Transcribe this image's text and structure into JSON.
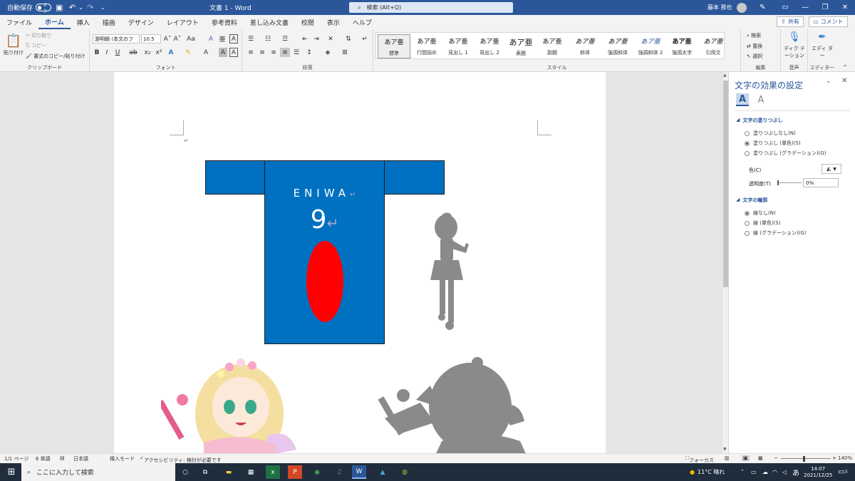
{
  "titlebar": {
    "autosave_label": "自動保存",
    "autosave_state": "オフ",
    "doc_title": "文書 1  -  Word",
    "search_placeholder": "検索 (Alt+Q)",
    "user_name": "藤本 那也"
  },
  "tabs": [
    "ファイル",
    "ホーム",
    "挿入",
    "描画",
    "デザイン",
    "レイアウト",
    "参考資料",
    "差し込み文書",
    "校閲",
    "表示",
    "ヘルプ"
  ],
  "active_tab": "ホーム",
  "share": {
    "share_label": "共有",
    "comment_label": "コメント"
  },
  "ribbon": {
    "clipboard": {
      "paste": "貼り付け",
      "cut": "切り取り",
      "copy": "コピー",
      "format_painter": "書式のコピー/貼り付け",
      "label": "クリップボード"
    },
    "font": {
      "font_name": "游明朝 (本文のフ",
      "font_size": "10.5",
      "label": "フォント"
    },
    "paragraph": {
      "label": "段落"
    },
    "styles": {
      "label": "スタイル",
      "items": [
        {
          "sample": "あア亜",
          "name": "標準"
        },
        {
          "sample": "あア亜",
          "name": "行間詰め"
        },
        {
          "sample": "あア亜",
          "name": "見出し 1"
        },
        {
          "sample": "あア亜",
          "name": "見出し 2"
        },
        {
          "sample": "あア亜",
          "name": "表題"
        },
        {
          "sample": "あア亜",
          "name": "副題"
        },
        {
          "sample": "あア亜",
          "name": "斜体"
        },
        {
          "sample": "あア亜",
          "name": "強調斜体"
        },
        {
          "sample": "あア亜",
          "name": "強調斜体 2"
        },
        {
          "sample": "あア亜",
          "name": "強調太字"
        },
        {
          "sample": "あア亜",
          "name": "引用文"
        }
      ]
    },
    "editing": {
      "find": "検索",
      "replace": "置換",
      "select": "選択",
      "label": "編集"
    },
    "voice": {
      "dictate": "ディク テーション",
      "label": "音声"
    },
    "editor": {
      "editor": "エディ ター",
      "label": "エディター"
    }
  },
  "document": {
    "shirt_text": "ENIWA",
    "shirt_number": "9",
    "colors": {
      "shirt": "#0070c0",
      "oval": "#ff0000",
      "silhouette": "#8a8a8a"
    }
  },
  "pane": {
    "title": "文字の効果の設定",
    "fill_section": "文字の塗りつぶし",
    "fill_options": [
      "塗りつぶしなし(N)",
      "塗りつぶし (単色)(S)",
      "塗りつぶし (グラデーション)(G)"
    ],
    "fill_selected": 1,
    "color_label": "色(C)",
    "transparency_label": "透明度(T)",
    "transparency_value": "0%",
    "outline_section": "文字の輪郭",
    "outline_options": [
      "線なし(N)",
      "線 (単色)(S)",
      "線 (グラデーション)(G)"
    ],
    "outline_selected": 0
  },
  "statusbar": {
    "page": "1/1 ページ",
    "words": "6 単語",
    "language": "日本語",
    "mode": "挿入モード",
    "accessibility": "アクセシビリティ: 検討が必要です",
    "focus": "フォーカス",
    "zoom": "140%"
  },
  "taskbar": {
    "search_placeholder": "ここに入力して検索",
    "weather": "11°C  晴れ",
    "ime": "あ",
    "time": "14:07",
    "date": "2021/12/25",
    "notif_count": "3"
  }
}
